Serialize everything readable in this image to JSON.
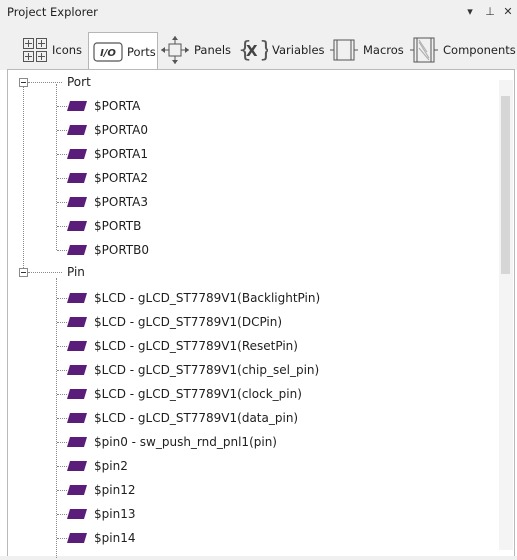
{
  "window": {
    "title": "Project Explorer",
    "buttons": {
      "dropdown": "▾",
      "pin": "⊥",
      "close": "✕"
    }
  },
  "tabs": [
    {
      "label": "Icons",
      "icon": "grid-icon"
    },
    {
      "label": "Ports",
      "icon": "io-icon",
      "active": true
    },
    {
      "label": "Panels",
      "icon": "move-arrows-icon"
    },
    {
      "label": "Variables",
      "icon": "braces-x-icon"
    },
    {
      "label": "Macros",
      "icon": "macro-block-icon"
    },
    {
      "label": "Components",
      "icon": "component-icon"
    }
  ],
  "tree": {
    "groups": [
      {
        "label": "Port",
        "expanded": true,
        "items": [
          "$PORTA",
          "$PORTA0",
          "$PORTA1",
          "$PORTA2",
          "$PORTA3",
          "$PORTB",
          "$PORTB0"
        ]
      },
      {
        "label": "Pin",
        "expanded": true,
        "items": [
          "$LCD - gLCD_ST7789V1(BacklightPin)",
          "$LCD - gLCD_ST7789V1(DCPin)",
          "$LCD - gLCD_ST7789V1(ResetPin)",
          "$LCD - gLCD_ST7789V1(chip_sel_pin)",
          "$LCD - gLCD_ST7789V1(clock_pin)",
          "$LCD - gLCD_ST7789V1(data_pin)",
          "$pin0 - sw_push_rnd_pnl1(pin)",
          "$pin2",
          "$pin12",
          "$pin13",
          "$pin14"
        ]
      }
    ]
  },
  "colors": {
    "item_icon": "#5a1d7a",
    "panel_bg": "#f0f0f0"
  }
}
